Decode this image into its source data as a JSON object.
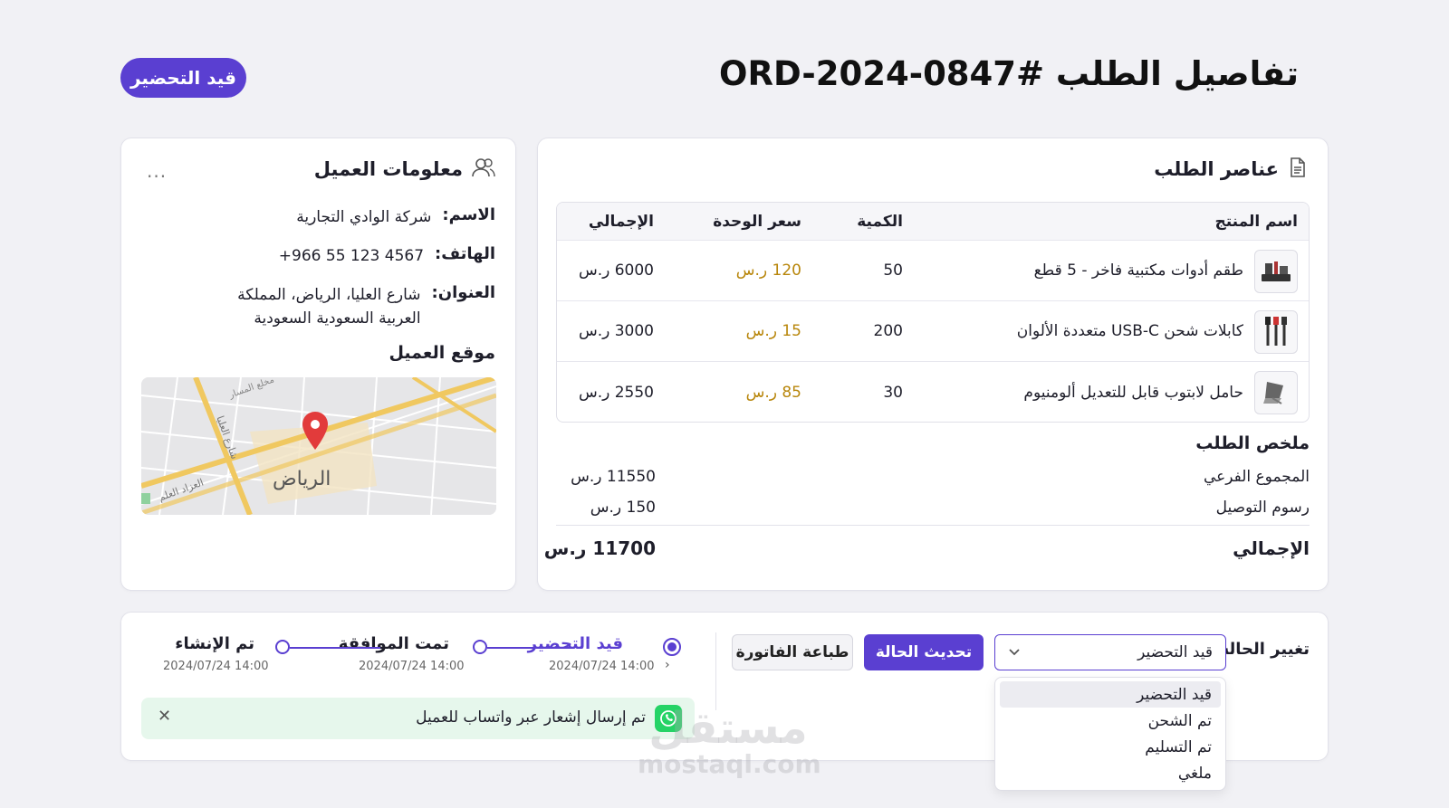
{
  "header": {
    "title": "تفاصيل الطلب #ORD-2024-0847",
    "status_badge": "قيد التحضير"
  },
  "items": {
    "heading": "عناصر الطلب",
    "columns": {
      "name": "اسم المنتج",
      "qty": "الكمية",
      "unit": "سعر الوحدة",
      "total": "الإجمالي"
    },
    "rows": [
      {
        "name": "طقم أدوات مكتبية فاخر - 5 قطع",
        "qty": "50",
        "unit": "120 ر.س",
        "total": "6000 ر.س",
        "icon": "desk-set-icon"
      },
      {
        "name": "كابلات شحن USB-C متعددة الألوان",
        "qty": "200",
        "unit": "15 ر.س",
        "total": "3000 ر.س",
        "icon": "cables-icon"
      },
      {
        "name": "حامل لابتوب قابل للتعديل ألومنيوم",
        "qty": "30",
        "unit": "85 ر.س",
        "total": "2550 ر.س",
        "icon": "laptop-stand-icon"
      }
    ]
  },
  "summary": {
    "heading": "ملخص الطلب",
    "subtotal_label": "المجموع الفرعي",
    "subtotal_value": "11550 ر.س",
    "shipping_label": "رسوم التوصيل",
    "shipping_value": "150 ر.س",
    "total_label": "الإجمالي",
    "total_value": "11700 ر.س"
  },
  "customer": {
    "heading": "معلومات العميل",
    "more": "···",
    "name_label": "الاسم:",
    "name_value": "شركة الوادي التجارية",
    "phone_label": "الهاتف:",
    "phone_value": "+966 55 123 4567",
    "address_label": "العنوان:",
    "address_value": "شارع العليا، الرياض، المملكة العربية السعودية السعودية",
    "location_heading": "موقع العميل",
    "map_city": "الرياض",
    "map_streets": [
      "شارع العليا",
      "العزاد العلم",
      "مخلع المسار"
    ]
  },
  "status_change": {
    "label": "تغيير الحالة",
    "selected": "قيد التحضير",
    "update_button": "تحديث الحالة",
    "print_button": "طباعة الفاتورة",
    "options": [
      "قيد التحضير",
      "تم الشحن",
      "تم التسليم",
      "ملغي"
    ]
  },
  "timeline": [
    {
      "label": "قيد التحضير",
      "date": "2024/07/24 14:00",
      "active": true
    },
    {
      "label": "تمت الموافقة",
      "date": "2024/07/24 14:00",
      "active": false
    },
    {
      "label": "تم الإنشاء",
      "date": "2024/07/24 14:00",
      "active": false
    }
  ],
  "notification": {
    "text": "تم إرسال إشعار عبر واتساب للعميل"
  },
  "watermark": {
    "ar": "مستقل",
    "en": "mostaql.com"
  },
  "colors": {
    "accent": "#5a3fd1",
    "price": "#b8860b",
    "success_bg": "#e6f7ec",
    "whatsapp": "#25d366"
  }
}
